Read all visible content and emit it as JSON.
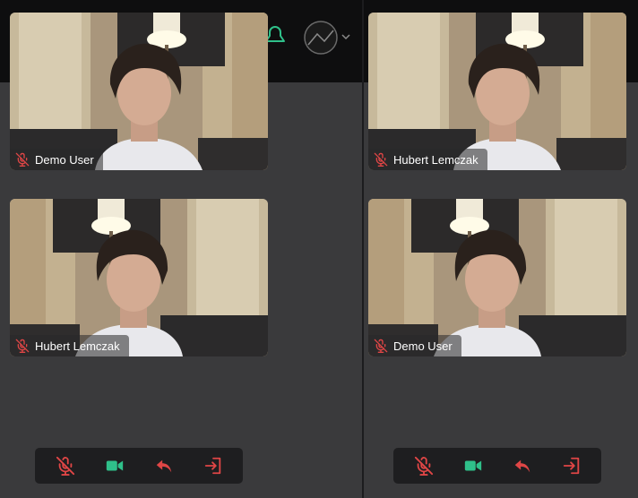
{
  "colors": {
    "background": "#3a3a3c",
    "header": "#0e0e0f",
    "controls_bar": "#1e1e20",
    "danger": "#e04646",
    "success": "#2fc08a"
  },
  "panes": [
    {
      "participants": [
        {
          "name": "Demo User",
          "muted": true,
          "mirrored": false
        },
        {
          "name": "Hubert Lemczak",
          "muted": true,
          "mirrored": true
        }
      ],
      "controls": {
        "mic": "mic-off-icon",
        "camera": "video-camera-icon",
        "share": "reply-arrow-icon",
        "leave": "leave-call-icon"
      }
    },
    {
      "participants": [
        {
          "name": "Hubert Lemczak",
          "muted": true,
          "mirrored": false
        },
        {
          "name": "Demo User",
          "muted": true,
          "mirrored": true
        }
      ],
      "controls": {
        "mic": "mic-off-icon",
        "camera": "video-camera-icon",
        "share": "reply-arrow-icon",
        "leave": "leave-call-icon"
      }
    }
  ]
}
